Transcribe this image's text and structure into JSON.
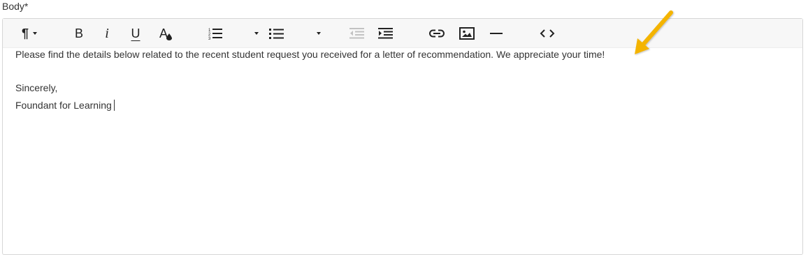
{
  "field": {
    "label": "Body*"
  },
  "toolbar": {
    "buttons": [
      {
        "name": "paragraph-format",
        "icon": "pilcrow-icon",
        "has_dropdown": true
      },
      {
        "name": "bold",
        "icon": "bold-icon"
      },
      {
        "name": "italic",
        "icon": "italic-icon"
      },
      {
        "name": "underline",
        "icon": "underline-icon"
      },
      {
        "name": "text-color",
        "icon": "text-color-icon"
      },
      {
        "name": "ordered-list",
        "icon": "ordered-list-icon",
        "has_dropdown": true
      },
      {
        "name": "unordered-list",
        "icon": "unordered-list-icon",
        "has_dropdown": true
      },
      {
        "name": "outdent",
        "icon": "outdent-icon",
        "disabled": true
      },
      {
        "name": "indent",
        "icon": "indent-icon"
      },
      {
        "name": "link",
        "icon": "link-icon"
      },
      {
        "name": "image",
        "icon": "image-icon"
      },
      {
        "name": "horizontal-line",
        "icon": "horizontal-rule-icon"
      },
      {
        "name": "code-view",
        "icon": "code-icon"
      }
    ],
    "glyphs": {
      "pilcrow": "¶",
      "bold": "B",
      "italic": "i",
      "underline": "U",
      "text_color": "A"
    }
  },
  "body": {
    "paragraph1": "Please find the details below related to the recent student request you received for a letter of recommendation. We appreciate your time!",
    "paragraph2": "Sincerely,",
    "paragraph3": "Foundant for Learning"
  },
  "annotation": {
    "arrow_color": "#f4b400"
  }
}
